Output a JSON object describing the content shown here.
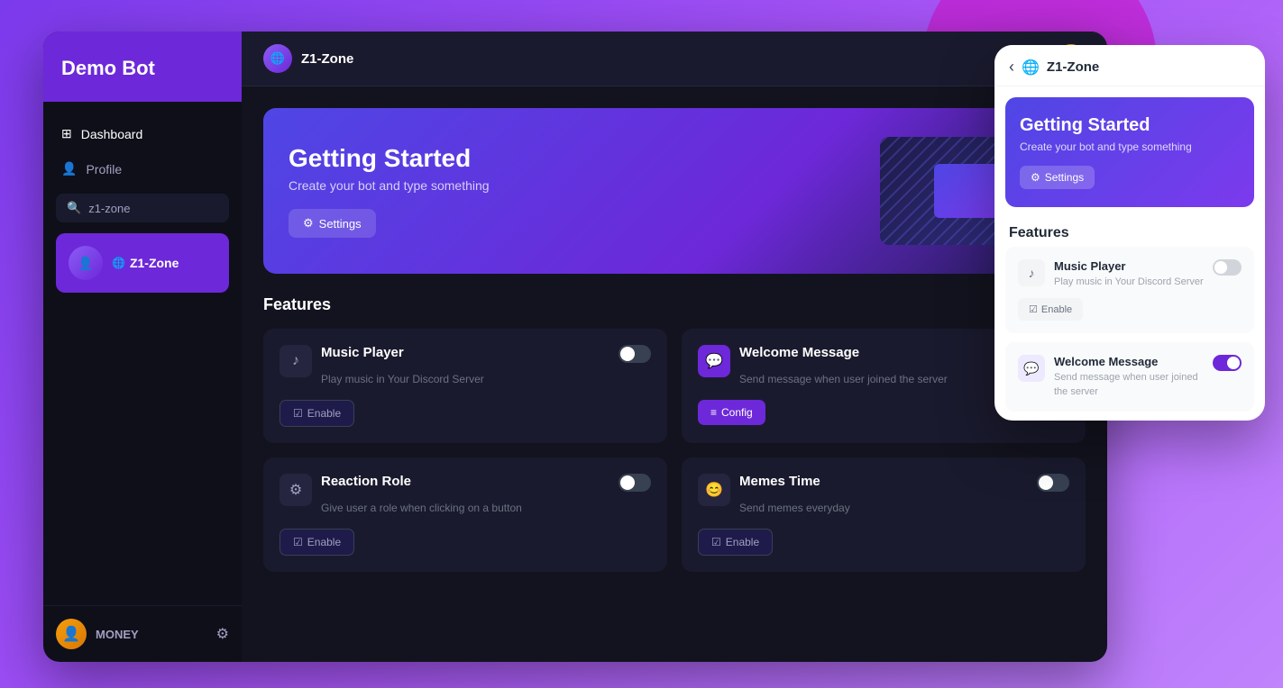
{
  "app": {
    "title": "Demo Bot"
  },
  "sidebar": {
    "logo": "Demo Bot",
    "nav": [
      {
        "id": "dashboard",
        "label": "Dashboard",
        "icon": "⊞"
      },
      {
        "id": "profile",
        "label": "Profile",
        "icon": "👤"
      }
    ],
    "search": {
      "placeholder": "z1-zone",
      "value": "z1-zone"
    },
    "server": {
      "name": "Z1-Zone",
      "icon": "🌐"
    },
    "user": {
      "name": "MONEY",
      "icon": "👤"
    }
  },
  "topbar": {
    "server_name": "Z1-Zone",
    "server_icon": "🌐"
  },
  "banner": {
    "title": "Getting Started",
    "subtitle": "Create your bot and type something",
    "settings_label": "Settings"
  },
  "features": {
    "section_title": "Features",
    "cards": [
      {
        "id": "music-player",
        "icon": "♪",
        "icon_style": "normal",
        "title": "Music Player",
        "description": "Play music in Your Discord Server",
        "toggle": false,
        "buttons": [
          "Enable"
        ]
      },
      {
        "id": "welcome-message",
        "icon": "💬",
        "icon_style": "purple",
        "title": "Welcome Message",
        "description": "Send message when user joined the server",
        "toggle": true,
        "buttons": [
          "Config"
        ]
      },
      {
        "id": "reaction-role",
        "icon": "⚙",
        "icon_style": "normal",
        "title": "Reaction Role",
        "description": "Give user a role when clicking on a button",
        "toggle": false,
        "buttons": [
          "Enable"
        ]
      },
      {
        "id": "memes-time",
        "icon": "😊",
        "icon_style": "normal",
        "title": "Memes Time",
        "description": "Send memes everyday",
        "toggle": false,
        "buttons": [
          "Enable"
        ]
      }
    ]
  },
  "mobile": {
    "server_name": "Z1-Zone",
    "back_icon": "‹",
    "banner": {
      "title": "Getting Started",
      "subtitle": "Create your bot and type something",
      "settings_label": "Settings"
    },
    "section_title": "Features",
    "features": [
      {
        "id": "music-player",
        "icon": "♪",
        "title": "Music Player",
        "description": "Play music in Your Discord Server",
        "toggle": false,
        "enable_label": "Enable"
      },
      {
        "id": "welcome-message",
        "icon": "💬",
        "title": "Welcome Message",
        "description": "Send message when user joined the server",
        "toggle": true
      }
    ]
  },
  "labels": {
    "enable": "Enable",
    "config": "Config",
    "settings": "Settings"
  },
  "colors": {
    "accent": "#6d28d9",
    "bg_dark": "#13131f",
    "sidebar_bg": "#0f0f1a",
    "card_bg": "#1a1a2e"
  }
}
